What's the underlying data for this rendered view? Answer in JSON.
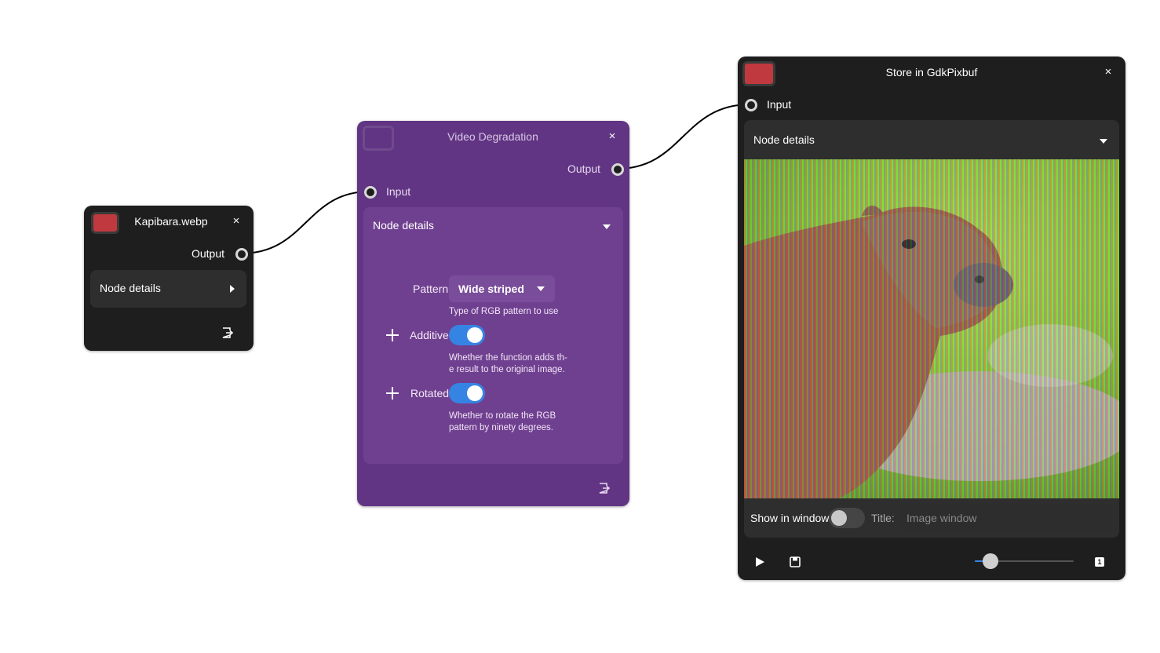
{
  "colors": {
    "node_dark": "#1e1e1e",
    "node_purple": "#613583",
    "details_dark": "#2e2e2e",
    "details_purple": "#704090",
    "swatch_red": "#c0393e",
    "toggle_on": "#3584e4"
  },
  "kapibara_node": {
    "title": "Kapibara.webp",
    "output_label": "Output",
    "details_label": "Node details",
    "close_glyph": "×"
  },
  "degradation_node": {
    "title": "Video Degradation",
    "output_label": "Output",
    "input_label": "Input",
    "details_label": "Node details",
    "close_glyph": "×",
    "pattern": {
      "label": "Pattern",
      "value": "Wide striped",
      "description": "Type of RGB pattern to use"
    },
    "additive": {
      "label": "Additive",
      "enabled": true,
      "description": "Whether the function adds th-e result to the original image."
    },
    "rotated": {
      "label": "Rotated",
      "enabled": true,
      "description": "Whether to rotate the RGB pattern by ninety degrees."
    }
  },
  "store_node": {
    "title": "Store in GdkPixbuf",
    "input_label": "Input",
    "details_label": "Node details",
    "close_glyph": "×",
    "show_in_window_label": "Show in window",
    "show_in_window": false,
    "title_label": "Title:",
    "title_placeholder": "Image window",
    "slider_value": 0.09,
    "page_badge": "1"
  }
}
